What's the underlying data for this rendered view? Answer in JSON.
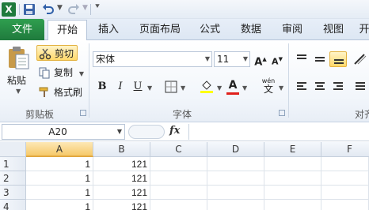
{
  "quick_access": {
    "app_icon": "excel-icon",
    "app_letter": "X",
    "buttons": [
      "save-icon",
      "undo-icon",
      "redo-icon",
      "customize-dropdown"
    ]
  },
  "tabs": {
    "file": "文件",
    "items": [
      "开始",
      "插入",
      "页面布局",
      "公式",
      "数据",
      "审阅",
      "视图",
      "开"
    ]
  },
  "clipboard": {
    "paste": "粘贴",
    "cut": "剪切",
    "copy": "复制",
    "format_painter": "格式刷",
    "group_label": "剪贴板"
  },
  "font": {
    "font_name": "宋体",
    "font_size": "11",
    "grow": "A",
    "shrink": "A",
    "bold": "B",
    "italic": "I",
    "underline": "U",
    "font_color_letter": "A",
    "phonetic": "wén",
    "phonetic_char": "文",
    "group_label": "字体",
    "highlight_color": "#ffff00",
    "font_color": "#e0201b"
  },
  "alignment": {
    "group_label": "对齐"
  },
  "formula_bar": {
    "name_box": "A20",
    "fx": "fx",
    "formula": ""
  },
  "sheet": {
    "columns": [
      "A",
      "B",
      "C",
      "D",
      "E",
      "F"
    ],
    "selected_column": "A",
    "rows": [
      {
        "num": "1",
        "A": "1",
        "B": "121"
      },
      {
        "num": "2",
        "A": "1",
        "B": "121"
      },
      {
        "num": "3",
        "A": "1",
        "B": "121"
      },
      {
        "num": "4",
        "A": "1",
        "B": "121"
      }
    ]
  }
}
